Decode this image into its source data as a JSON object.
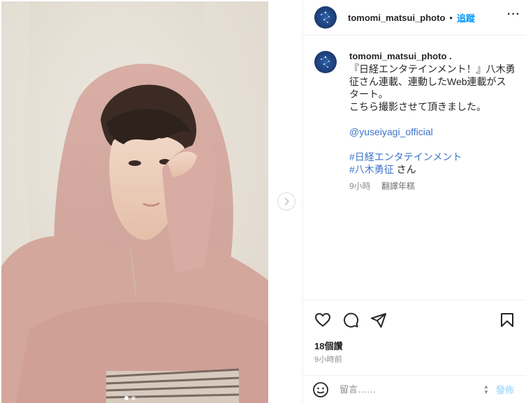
{
  "header": {
    "username": "tomomi_matsui_photo",
    "separator": "•",
    "follow_label": "追蹤",
    "more_label": "···"
  },
  "caption": {
    "username": "tomomi_matsui_photo .",
    "line1": "『日経エンタテインメント！』八木勇征さん連載、連動したWeb連載がスタート。\nこちら撮影させて頂きました。",
    "mention": "@yuseiyagi_official",
    "hashtag1": "#日経エンタテインメント",
    "hashtag2": "#八木勇征",
    "hashtag2_suffix": " さん",
    "time": "9小時",
    "translate_label": "翻譯年糕"
  },
  "actions": {
    "like_icon": "heart-icon",
    "comment_icon": "comment-icon",
    "share_icon": "send-icon",
    "save_icon": "bookmark-icon"
  },
  "stats": {
    "likes": "18個讚",
    "posted": "9小時前"
  },
  "comment": {
    "placeholder": "留言……",
    "post_label": "發佈"
  },
  "media": {
    "carousel_total": 2,
    "carousel_active": 1,
    "description_icon": "chevron-right-icon"
  },
  "colors": {
    "accent": "#0095f6",
    "link": "#3d73c9",
    "muted": "#8e8e8e",
    "text": "#262626",
    "border": "#efefef"
  }
}
